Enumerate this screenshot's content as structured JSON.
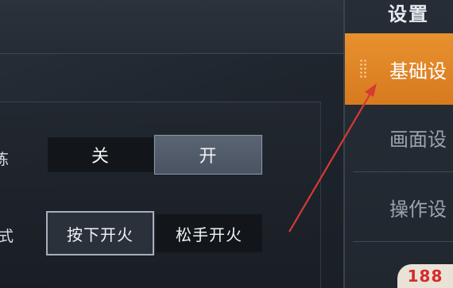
{
  "sidebar": {
    "title": "设置",
    "items": [
      {
        "label": "基础设",
        "active": true
      },
      {
        "label": "画面设",
        "active": false
      },
      {
        "label": "操作设",
        "active": false
      }
    ]
  },
  "rows": [
    {
      "label_fragment": "炼",
      "options": [
        {
          "label": "关",
          "selected": false
        },
        {
          "label": "开",
          "selected": true
        }
      ]
    },
    {
      "label_fragment": "式",
      "options": [
        {
          "label": "按下开火",
          "selected": true
        },
        {
          "label": "松手开火",
          "selected": false
        }
      ]
    }
  ],
  "watermark": {
    "text": "188"
  },
  "colors": {
    "accent_orange": "#e8912e",
    "annotation_red": "#d63a34",
    "panel_dark": "#12161b"
  }
}
